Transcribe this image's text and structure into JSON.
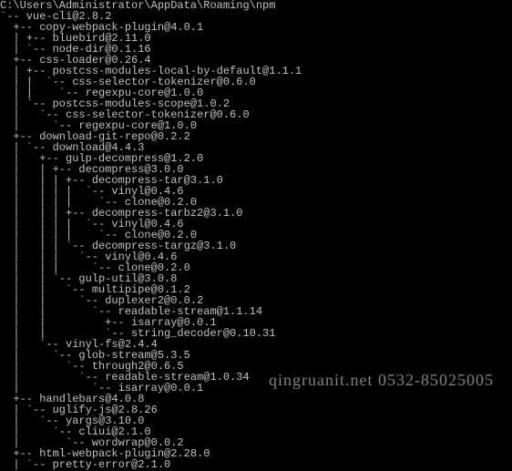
{
  "lines": [
    "C:\\Users\\Administrator\\AppData\\Roaming\\npm",
    "`-- vue-cli@2.8.2",
    "  +-- copy-webpack-plugin@4.0.1",
    "  | +-- bluebird@2.11.0",
    "  | `-- node-dir@0.1.16",
    "  +-- css-loader@0.26.4",
    "  | +-- postcss-modules-local-by-default@1.1.1",
    "  | |  `-- css-selector-tokenizer@0.6.0",
    "  | |    `-- regexpu-core@1.0.0",
    "  | `-- postcss-modules-scope@1.0.2",
    "  |   `-- css-selector-tokenizer@0.6.0",
    "  |     `-- regexpu-core@1.0.0",
    "  +-- download-git-repo@0.2.2",
    "  | `-- download@4.4.3",
    "  |   +-- gulp-decompress@1.2.0",
    "  |   | +-- decompress@3.0.0",
    "  |   | | +-- decompress-tar@3.1.0",
    "  |   | | |  `-- vinyl@0.4.6",
    "  |   | | |    `-- clone@0.2.0",
    "  |   | | +-- decompress-tarbz2@3.1.0",
    "  |   | | |  `-- vinyl@0.4.6",
    "  |   | | |    `-- clone@0.2.0",
    "  |   | | `-- decompress-targz@3.1.0",
    "  |   | |   `-- vinyl@0.4.6",
    "  |   | |     `-- clone@0.2.0",
    "  |   | `-- gulp-util@3.0.8",
    "  |   |   `-- multipipe@0.1.2",
    "  |   |     `-- duplexer2@0.0.2",
    "  |   |       `-- readable-stream@1.1.14",
    "  |   |         +-- isarray@0.0.1",
    "  |   |         `-- string_decoder@0.10.31",
    "  |   `-- vinyl-fs@2.4.4",
    "  |     `-- glob-stream@5.3.5",
    "  |       `-- through2@0.6.5",
    "  |         `-- readable-stream@1.0.34",
    "  |           `-- isarray@0.0.1",
    "  +-- handlebars@4.0.8",
    "  | `-- uglify-js@2.8.26",
    "  |   `-- yargs@3.10.0",
    "  |     `-- cliui@2.1.0",
    "  |       `-- wordwrap@0.0.2",
    "  +-- html-webpack-plugin@2.28.0",
    "  | `-- pretty-error@2.1.0"
  ],
  "watermark": "qingruanit.net 0532-85025005"
}
